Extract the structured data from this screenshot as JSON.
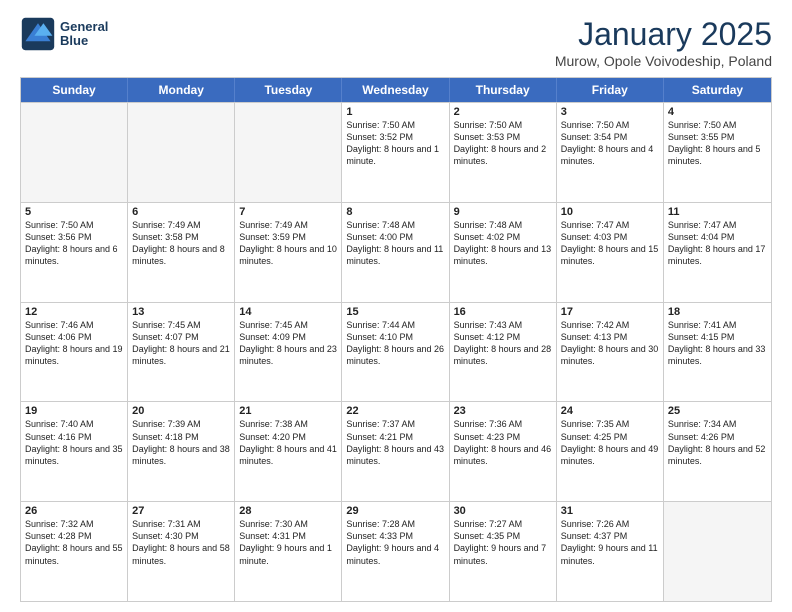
{
  "logo": {
    "line1": "General",
    "line2": "Blue"
  },
  "title": "January 2025",
  "subtitle": "Murow, Opole Voivodeship, Poland",
  "weekdays": [
    "Sunday",
    "Monday",
    "Tuesday",
    "Wednesday",
    "Thursday",
    "Friday",
    "Saturday"
  ],
  "weeks": [
    [
      {
        "day": "",
        "info": ""
      },
      {
        "day": "",
        "info": ""
      },
      {
        "day": "",
        "info": ""
      },
      {
        "day": "1",
        "info": "Sunrise: 7:50 AM\nSunset: 3:52 PM\nDaylight: 8 hours\nand 1 minute."
      },
      {
        "day": "2",
        "info": "Sunrise: 7:50 AM\nSunset: 3:53 PM\nDaylight: 8 hours\nand 2 minutes."
      },
      {
        "day": "3",
        "info": "Sunrise: 7:50 AM\nSunset: 3:54 PM\nDaylight: 8 hours\nand 4 minutes."
      },
      {
        "day": "4",
        "info": "Sunrise: 7:50 AM\nSunset: 3:55 PM\nDaylight: 8 hours\nand 5 minutes."
      }
    ],
    [
      {
        "day": "5",
        "info": "Sunrise: 7:50 AM\nSunset: 3:56 PM\nDaylight: 8 hours\nand 6 minutes."
      },
      {
        "day": "6",
        "info": "Sunrise: 7:49 AM\nSunset: 3:58 PM\nDaylight: 8 hours\nand 8 minutes."
      },
      {
        "day": "7",
        "info": "Sunrise: 7:49 AM\nSunset: 3:59 PM\nDaylight: 8 hours\nand 10 minutes."
      },
      {
        "day": "8",
        "info": "Sunrise: 7:48 AM\nSunset: 4:00 PM\nDaylight: 8 hours\nand 11 minutes."
      },
      {
        "day": "9",
        "info": "Sunrise: 7:48 AM\nSunset: 4:02 PM\nDaylight: 8 hours\nand 13 minutes."
      },
      {
        "day": "10",
        "info": "Sunrise: 7:47 AM\nSunset: 4:03 PM\nDaylight: 8 hours\nand 15 minutes."
      },
      {
        "day": "11",
        "info": "Sunrise: 7:47 AM\nSunset: 4:04 PM\nDaylight: 8 hours\nand 17 minutes."
      }
    ],
    [
      {
        "day": "12",
        "info": "Sunrise: 7:46 AM\nSunset: 4:06 PM\nDaylight: 8 hours\nand 19 minutes."
      },
      {
        "day": "13",
        "info": "Sunrise: 7:45 AM\nSunset: 4:07 PM\nDaylight: 8 hours\nand 21 minutes."
      },
      {
        "day": "14",
        "info": "Sunrise: 7:45 AM\nSunset: 4:09 PM\nDaylight: 8 hours\nand 23 minutes."
      },
      {
        "day": "15",
        "info": "Sunrise: 7:44 AM\nSunset: 4:10 PM\nDaylight: 8 hours\nand 26 minutes."
      },
      {
        "day": "16",
        "info": "Sunrise: 7:43 AM\nSunset: 4:12 PM\nDaylight: 8 hours\nand 28 minutes."
      },
      {
        "day": "17",
        "info": "Sunrise: 7:42 AM\nSunset: 4:13 PM\nDaylight: 8 hours\nand 30 minutes."
      },
      {
        "day": "18",
        "info": "Sunrise: 7:41 AM\nSunset: 4:15 PM\nDaylight: 8 hours\nand 33 minutes."
      }
    ],
    [
      {
        "day": "19",
        "info": "Sunrise: 7:40 AM\nSunset: 4:16 PM\nDaylight: 8 hours\nand 35 minutes."
      },
      {
        "day": "20",
        "info": "Sunrise: 7:39 AM\nSunset: 4:18 PM\nDaylight: 8 hours\nand 38 minutes."
      },
      {
        "day": "21",
        "info": "Sunrise: 7:38 AM\nSunset: 4:20 PM\nDaylight: 8 hours\nand 41 minutes."
      },
      {
        "day": "22",
        "info": "Sunrise: 7:37 AM\nSunset: 4:21 PM\nDaylight: 8 hours\nand 43 minutes."
      },
      {
        "day": "23",
        "info": "Sunrise: 7:36 AM\nSunset: 4:23 PM\nDaylight: 8 hours\nand 46 minutes."
      },
      {
        "day": "24",
        "info": "Sunrise: 7:35 AM\nSunset: 4:25 PM\nDaylight: 8 hours\nand 49 minutes."
      },
      {
        "day": "25",
        "info": "Sunrise: 7:34 AM\nSunset: 4:26 PM\nDaylight: 8 hours\nand 52 minutes."
      }
    ],
    [
      {
        "day": "26",
        "info": "Sunrise: 7:32 AM\nSunset: 4:28 PM\nDaylight: 8 hours\nand 55 minutes."
      },
      {
        "day": "27",
        "info": "Sunrise: 7:31 AM\nSunset: 4:30 PM\nDaylight: 8 hours\nand 58 minutes."
      },
      {
        "day": "28",
        "info": "Sunrise: 7:30 AM\nSunset: 4:31 PM\nDaylight: 9 hours\nand 1 minute."
      },
      {
        "day": "29",
        "info": "Sunrise: 7:28 AM\nSunset: 4:33 PM\nDaylight: 9 hours\nand 4 minutes."
      },
      {
        "day": "30",
        "info": "Sunrise: 7:27 AM\nSunset: 4:35 PM\nDaylight: 9 hours\nand 7 minutes."
      },
      {
        "day": "31",
        "info": "Sunrise: 7:26 AM\nSunset: 4:37 PM\nDaylight: 9 hours\nand 11 minutes."
      },
      {
        "day": "",
        "info": ""
      }
    ]
  ]
}
